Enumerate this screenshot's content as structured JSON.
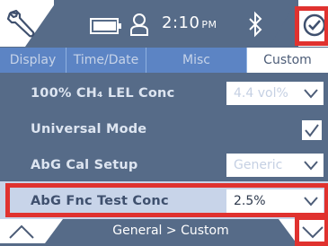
{
  "status": {
    "time": "2:10",
    "ampm": "PM",
    "icons": [
      "wrench-icon",
      "battery-icon",
      "user-icon",
      "bluetooth-icon",
      "check-circle-icon"
    ]
  },
  "tabs": [
    {
      "label": "Display"
    },
    {
      "label": "Time/Date"
    },
    {
      "label": "Misc"
    },
    {
      "label": "Custom"
    }
  ],
  "rows": [
    {
      "label": "100% CH₄ LEL Conc",
      "value": "4.4 vol%"
    },
    {
      "label": "Universal Mode",
      "checked": true
    },
    {
      "label": "AbG Cal Setup",
      "value": "Generic"
    },
    {
      "label": "AbG Fnc Test Conc",
      "value": "2.5%"
    }
  ],
  "breadcrumb": "General > Custom",
  "colors": {
    "highlight": "#e0322f",
    "header": "#566b88",
    "tab": "#5c84c4"
  }
}
